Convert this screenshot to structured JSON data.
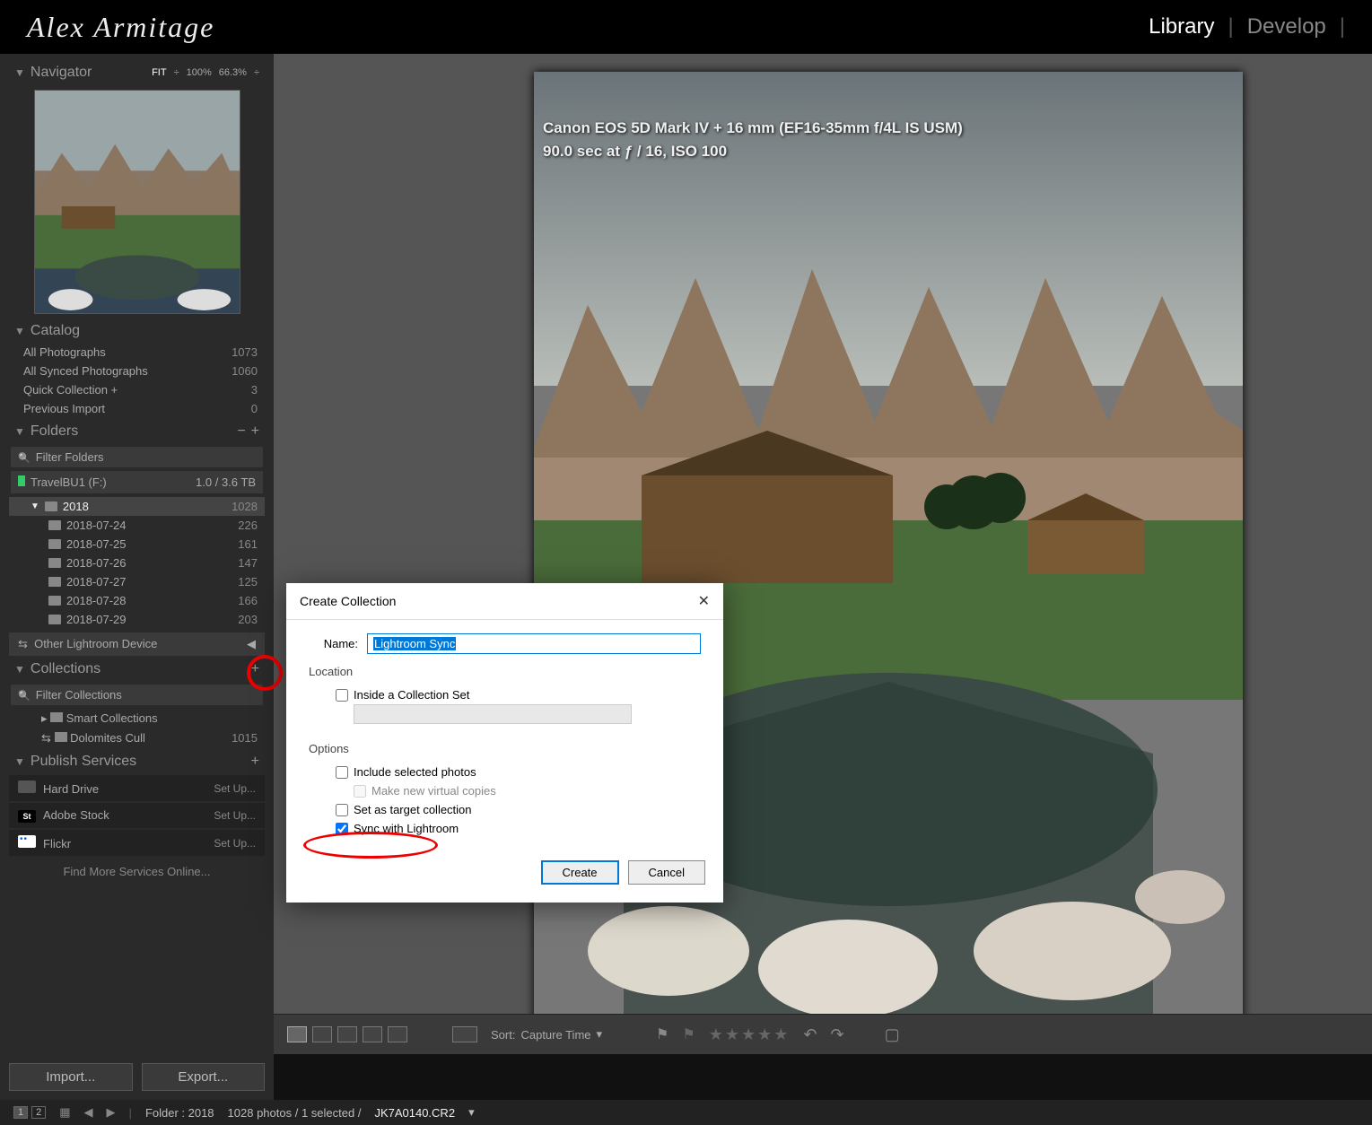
{
  "topbar": {
    "signature": "Alex Armitage",
    "modules": {
      "library": "Library",
      "develop": "Develop"
    }
  },
  "navigator": {
    "title": "Navigator",
    "fit": "FIT",
    "fill": "100%",
    "zoom": "66.3%"
  },
  "catalog": {
    "title": "Catalog",
    "items": [
      {
        "label": "All Photographs",
        "count": "1073"
      },
      {
        "label": "All Synced Photographs",
        "count": "1060"
      },
      {
        "label": "Quick Collection  +",
        "count": "3"
      },
      {
        "label": "Previous Import",
        "count": "0"
      }
    ]
  },
  "folders": {
    "title": "Folders",
    "filter_placeholder": "Filter Folders",
    "volume": {
      "name": "TravelBU1 (F:)",
      "usage": "1.0 / 3.6 TB"
    },
    "root": {
      "name": "2018",
      "count": "1028"
    },
    "children": [
      {
        "name": "2018-07-24",
        "count": "226"
      },
      {
        "name": "2018-07-25",
        "count": "161"
      },
      {
        "name": "2018-07-26",
        "count": "147"
      },
      {
        "name": "2018-07-27",
        "count": "125"
      },
      {
        "name": "2018-07-28",
        "count": "166"
      },
      {
        "name": "2018-07-29",
        "count": "203"
      }
    ],
    "other_device": "Other Lightroom Device"
  },
  "collections": {
    "title": "Collections",
    "filter_placeholder": "Filter Collections",
    "items": [
      {
        "name": "Smart Collections",
        "count": ""
      },
      {
        "name": "Dolomites Cull",
        "count": "1015"
      }
    ]
  },
  "publish": {
    "title": "Publish Services",
    "items": [
      {
        "name": "Hard Drive",
        "action": "Set Up..."
      },
      {
        "name": "Adobe Stock",
        "action": "Set Up..."
      },
      {
        "name": "Flickr",
        "action": "Set Up..."
      }
    ],
    "find_more": "Find More Services Online..."
  },
  "left_buttons": {
    "import": "Import...",
    "export": "Export..."
  },
  "metadata": {
    "line1": "Canon EOS 5D Mark IV + 16 mm (EF16-35mm f/4L IS USM)",
    "line2": "90.0 sec at ƒ / 16, ISO 100"
  },
  "bottom_tools": {
    "sort_label": "Sort:",
    "sort_value": "Capture Time"
  },
  "statusbar": {
    "folder_label": "Folder : 2018",
    "count": "1028 photos / 1 selected /",
    "filename": "JK7A0140.CR2"
  },
  "dialog": {
    "title": "Create Collection",
    "name_label": "Name:",
    "name_value": "Lightroom Sync",
    "location_label": "Location",
    "inside_set": "Inside a Collection Set",
    "options_label": "Options",
    "include_photos": "Include selected photos",
    "virtual_copies": "Make new virtual copies",
    "target_collection": "Set as target collection",
    "sync_lightroom": "Sync with Lightroom",
    "create": "Create",
    "cancel": "Cancel"
  }
}
